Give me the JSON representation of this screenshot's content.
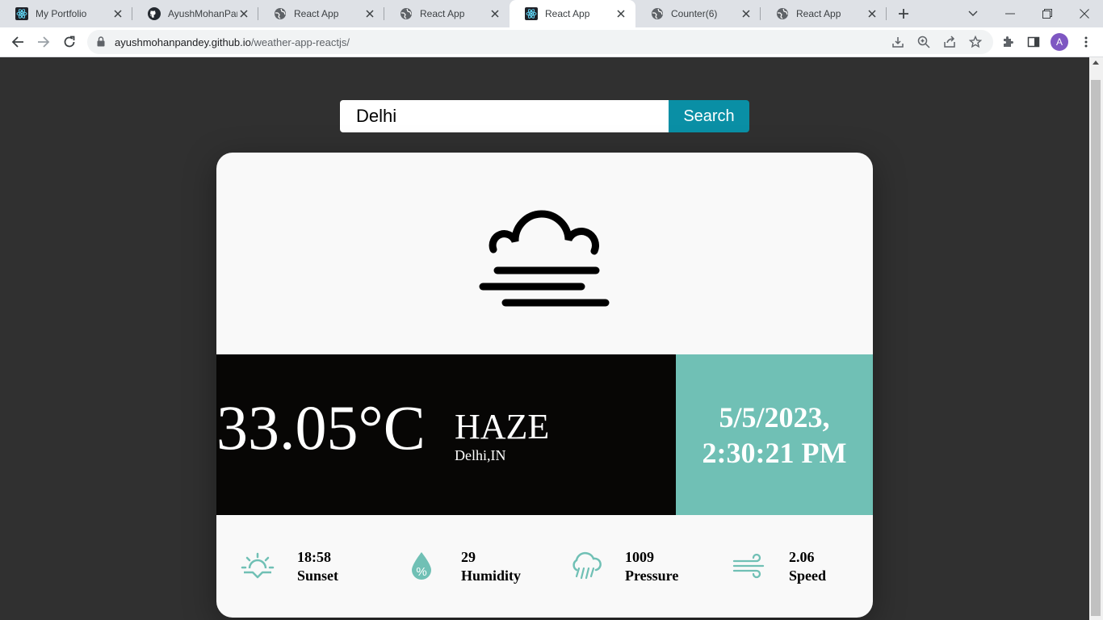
{
  "browser": {
    "tabs": [
      {
        "title": "My Portfolio",
        "icon": "react-icon",
        "active": false
      },
      {
        "title": "AyushMohanPandey",
        "icon": "github-icon",
        "active": false
      },
      {
        "title": "React App",
        "icon": "globe-icon",
        "active": false
      },
      {
        "title": "React App",
        "icon": "globe-icon",
        "active": false
      },
      {
        "title": "React App",
        "icon": "react-icon",
        "active": true
      },
      {
        "title": "Counter(6)",
        "icon": "globe-icon",
        "active": false
      },
      {
        "title": "React App",
        "icon": "globe-icon",
        "active": false
      }
    ],
    "url_domain": "ayushmohanpandey.github.io",
    "url_path": "/weather-app-reactjs/",
    "profile_initial": "A",
    "accent_color": "#7e57c2"
  },
  "app": {
    "search": {
      "value": "Delhi",
      "button_label": "Search",
      "button_color": "#0a8fa5"
    },
    "weather": {
      "icon": "haze-icon",
      "temperature": "33.05°C",
      "condition": "HAZE",
      "location": "Delhi,IN",
      "date": "5/5/2023,",
      "time": "2:30:21 PM",
      "date_panel_color": "#70c0b5"
    },
    "stats": [
      {
        "icon": "sunset-icon",
        "value": "18:58",
        "label": "Sunset"
      },
      {
        "icon": "humidity-icon",
        "value": "29",
        "label": "Humidity"
      },
      {
        "icon": "pressure-icon",
        "value": "1009",
        "label": "Pressure"
      },
      {
        "icon": "wind-icon",
        "value": "2.06",
        "label": "Speed"
      }
    ],
    "icon_color": "#70c0b5"
  }
}
